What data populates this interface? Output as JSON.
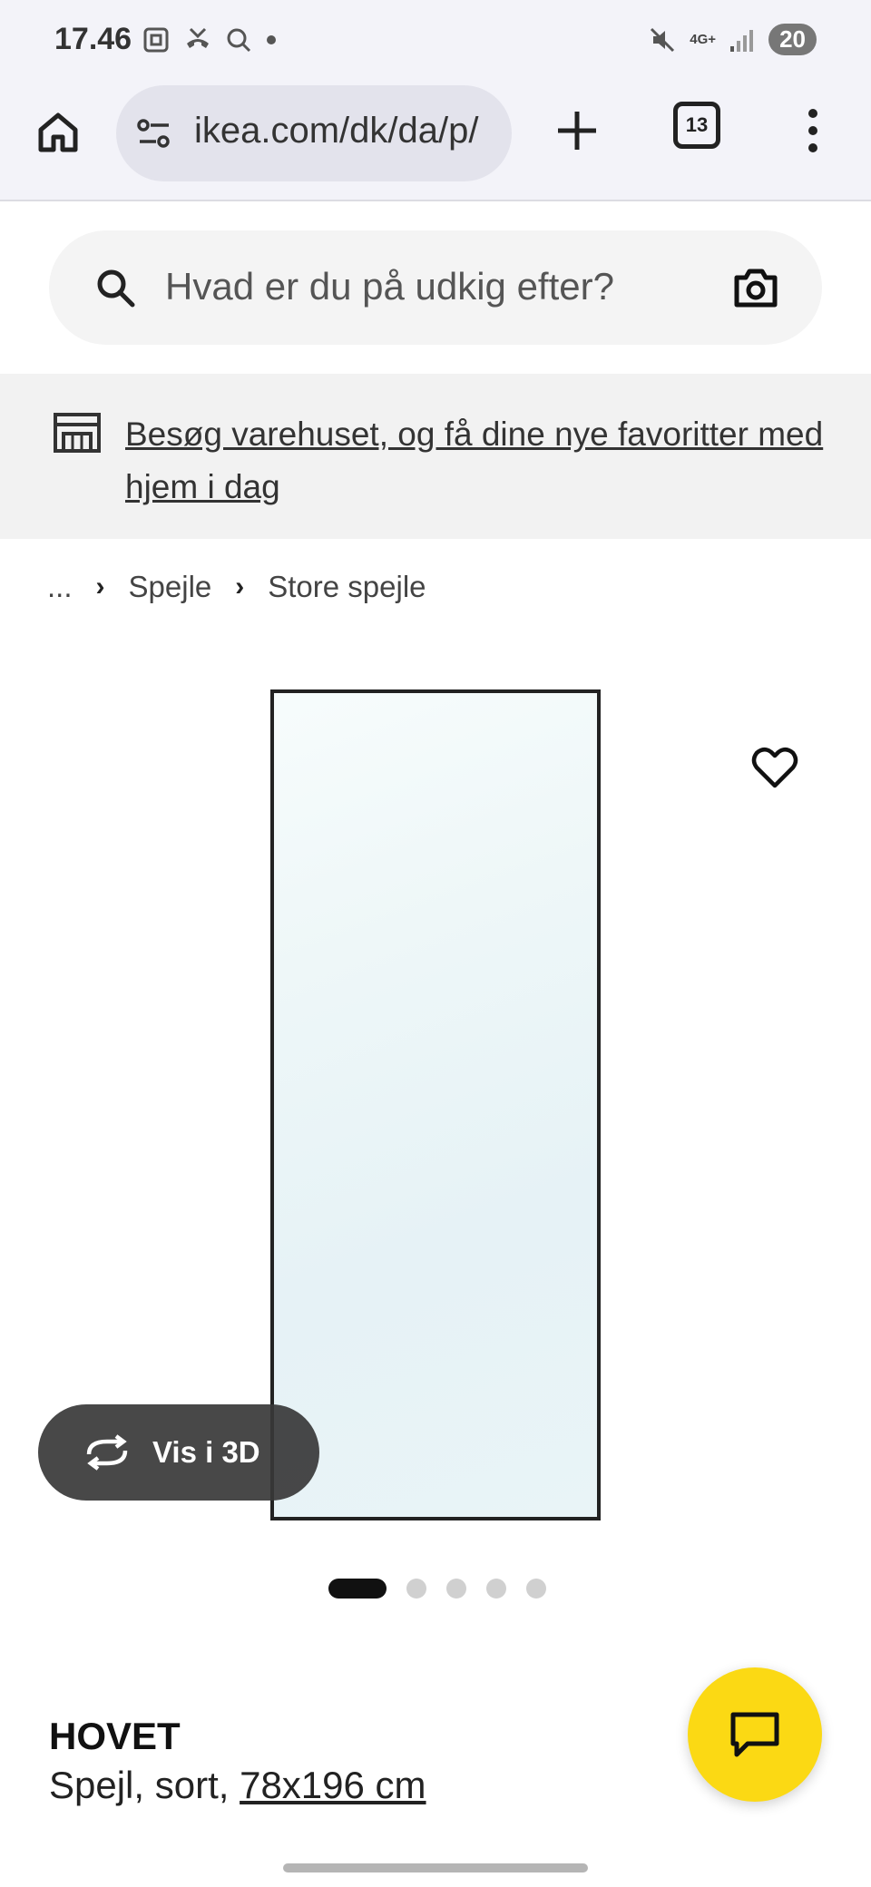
{
  "status_bar": {
    "time": "17.46",
    "network": "4G+",
    "battery": "20"
  },
  "browser": {
    "url": "ikea.com/dk/da/p/",
    "tab_count": "13"
  },
  "search": {
    "placeholder": "Hvad er du på udkig efter?"
  },
  "store_banner": {
    "text": "Besøg varehuset, og få dine nye favoritter med hjem i dag"
  },
  "breadcrumb": {
    "items": [
      "...",
      "Spejle",
      "Store spejle"
    ]
  },
  "gallery": {
    "view_3d_label": "Vis i 3D",
    "image_count": 5,
    "active_index": 0
  },
  "product": {
    "name": "HOVET",
    "description": "Spejl, sort, ",
    "size": "78x196 cm"
  },
  "colors": {
    "chat_fab": "#fbd914",
    "browser_bg": "#f3f3f9"
  }
}
